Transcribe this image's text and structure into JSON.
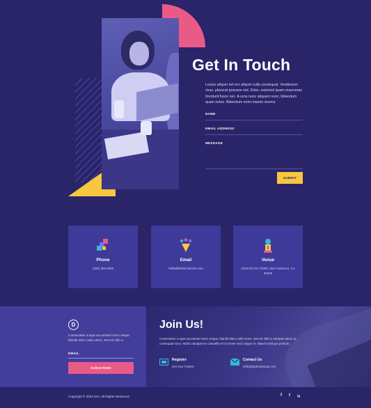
{
  "contact": {
    "title": "Get In Touch",
    "description": "Luctus aliquet vel orci aliquet nulla consequat. Vestibulum risus, placerat posuere nisl. Dolor, euismod quam maecenas tincidunt fusce nec. A urna nunc aliquam nunc, bibendum quam netus. Bibendum enim mauris viverra.",
    "name_label": "NAME",
    "email_label": "EMAIL ADDRESS",
    "message_label": "MESSAGE",
    "submit_label": "SUBMIT"
  },
  "cards": [
    {
      "icon": "phone-icon",
      "title": "Phone",
      "text": "(255) 352-6258"
    },
    {
      "icon": "email-icon",
      "title": "Email",
      "text": "hello@divitechnician.com"
    },
    {
      "icon": "venue-icon",
      "title": "Venue",
      "text": "1234 Divi St. #1000, San Francisco, CA 94220"
    }
  ],
  "newsletter": {
    "logo_letter": "D",
    "text": "Consectetur a eget accumsan lorem neque, blandit diam nulla netus. Sed sit nibh a.",
    "email_label": "EMAIL",
    "subscribe_label": "SUBSCRIBE"
  },
  "join": {
    "title": "Join Us!",
    "text": "Consectetur a eget accumsan lorem neque, blandit diam nulla netus. Sed sit nibh a volutpat varius ac consequat nunc. Morbi volutpat leo convallis et id ornare sed congue et. Mauris tristique pretium.",
    "register_title": "Register",
    "register_sub": "Get Your Tickets!",
    "contact_title": "Contact Us",
    "contact_sub": "hello@divitechnician.com"
  },
  "footer": {
    "copyright": "Copyright © 2022 Divi. All Rights Reserved.",
    "social": [
      "f",
      "t",
      "ig"
    ]
  },
  "colors": {
    "background": "#2a2469",
    "card": "#3e3a9a",
    "pink": "#ea5a86",
    "yellow": "#f9c640",
    "cyan": "#38b6d8"
  }
}
